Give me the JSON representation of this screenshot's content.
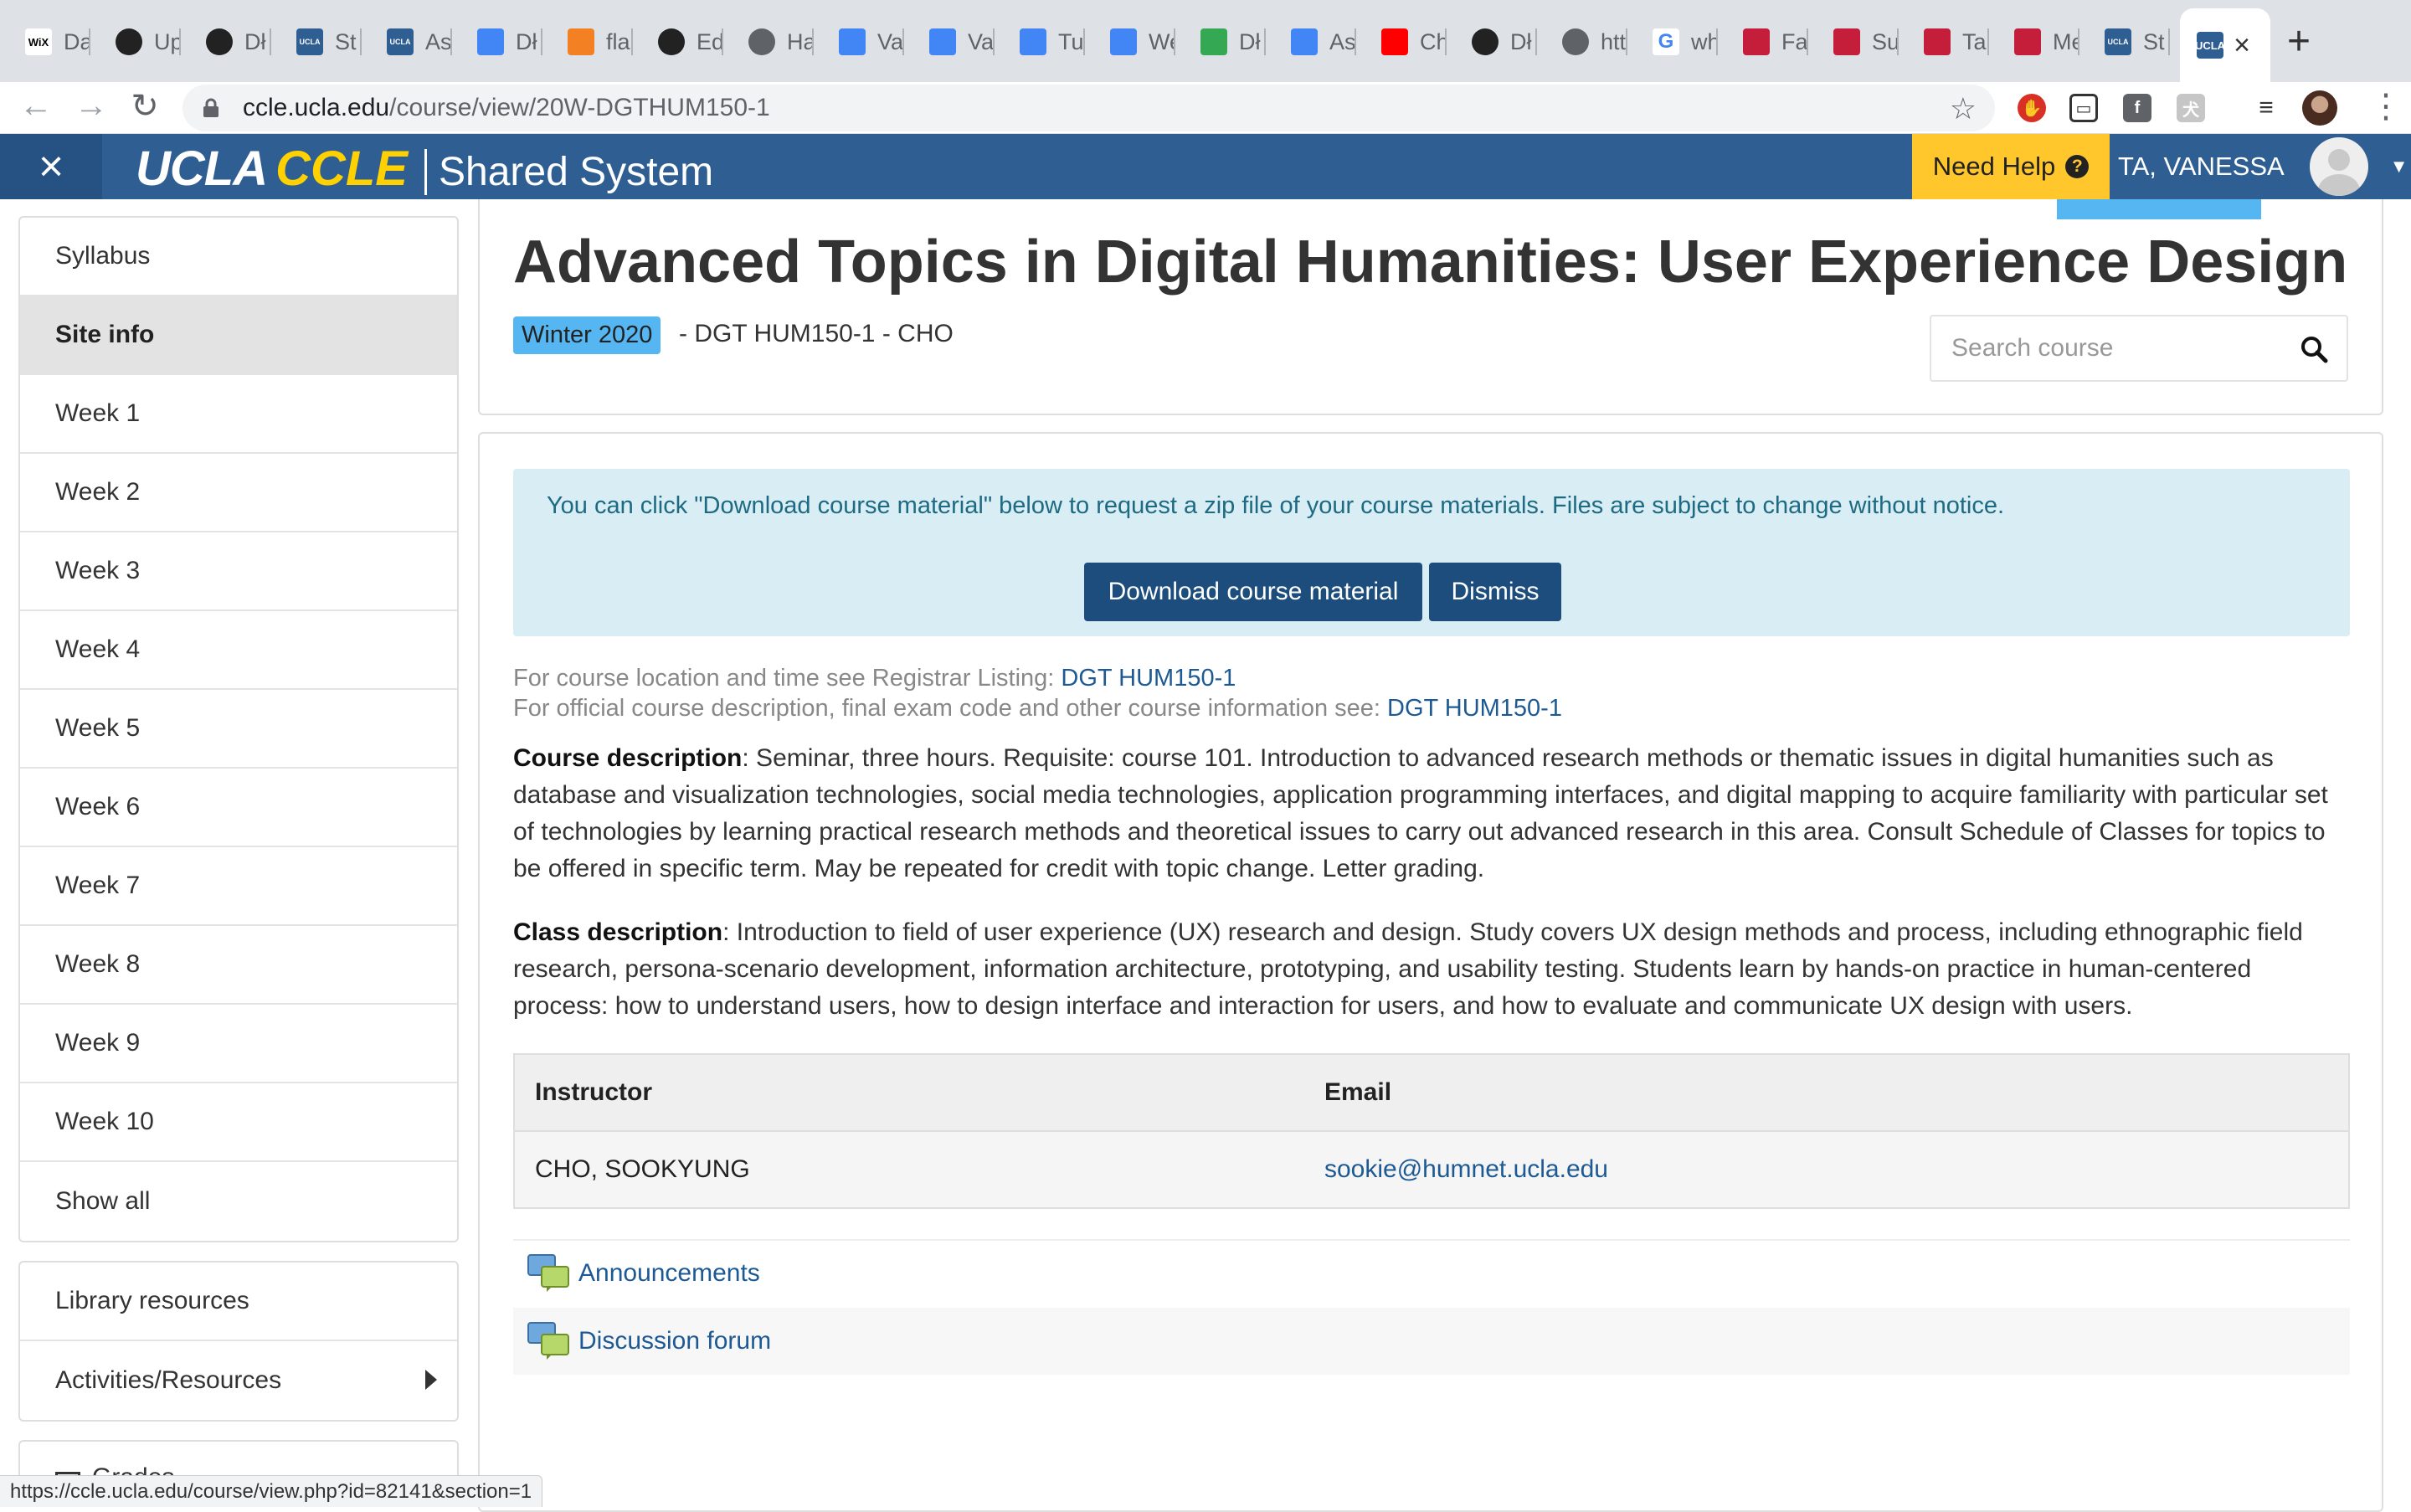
{
  "browser": {
    "tabs": [
      {
        "label": "Da",
        "icon": "wix-icon",
        "color": "#ffffff"
      },
      {
        "label": "Up",
        "icon": "github-icon",
        "color": "#222222"
      },
      {
        "label": "Dł",
        "icon": "github-icon",
        "color": "#222222"
      },
      {
        "label": "St",
        "icon": "ucla-icon",
        "color": "#2f5e93"
      },
      {
        "label": "As",
        "icon": "ucla-icon",
        "color": "#2f5e93"
      },
      {
        "label": "Dł",
        "icon": "docs-icon",
        "color": "#4285f4"
      },
      {
        "label": "fla",
        "icon": "stackoverflow-icon",
        "color": "#f48024"
      },
      {
        "label": "Ed",
        "icon": "github-icon",
        "color": "#222222"
      },
      {
        "label": "Ha",
        "icon": "globe-icon",
        "color": "#5f6368"
      },
      {
        "label": "Va",
        "icon": "docs-icon",
        "color": "#4285f4"
      },
      {
        "label": "Va",
        "icon": "docs-icon",
        "color": "#4285f4"
      },
      {
        "label": "Tu",
        "icon": "docs-icon",
        "color": "#4285f4"
      },
      {
        "label": "We",
        "icon": "docs-icon",
        "color": "#4285f4"
      },
      {
        "label": "Dł",
        "icon": "drive-icon",
        "color": "#34a853"
      },
      {
        "label": "As",
        "icon": "docs-icon",
        "color": "#4285f4"
      },
      {
        "label": "Ch",
        "icon": "youtube-icon",
        "color": "#ff0000"
      },
      {
        "label": "Dł",
        "icon": "github-icon",
        "color": "#222222"
      },
      {
        "label": "htt",
        "icon": "globe-icon",
        "color": "#5f6368"
      },
      {
        "label": "wh",
        "icon": "google-icon",
        "color": "#4285f4"
      },
      {
        "label": "Fa",
        "icon": "hyperlink-icon",
        "color": "#c41e3a"
      },
      {
        "label": "Su",
        "icon": "hyperlink-icon",
        "color": "#c41e3a"
      },
      {
        "label": "Ta",
        "icon": "hyperlink-icon",
        "color": "#c41e3a"
      },
      {
        "label": "Me",
        "icon": "hyperlink-icon",
        "color": "#c41e3a"
      },
      {
        "label": "St",
        "icon": "ucla-icon",
        "color": "#2f5e93"
      }
    ],
    "url_host": "ccle.ucla.edu",
    "url_path": "/course/view/20W-DGTHUM150-1",
    "status_url": "https://ccle.ucla.edu/course/view.php?id=82141&section=1"
  },
  "header": {
    "brand_ucla": "UCLA",
    "brand_ccle": "CCLE",
    "brand_system": "Shared System",
    "need_help": "Need Help",
    "user_name": "TA, VANESSA",
    "colors": {
      "bar": "#2f5e93",
      "help": "#ffc72c",
      "brand_gold": "#ffd100"
    }
  },
  "sidebar": {
    "items": [
      {
        "label": "Syllabus",
        "active": false
      },
      {
        "label": "Site info",
        "active": true
      },
      {
        "label": "Week 1",
        "active": false
      },
      {
        "label": "Week 2",
        "active": false
      },
      {
        "label": "Week 3",
        "active": false
      },
      {
        "label": "Week 4",
        "active": false
      },
      {
        "label": "Week 5",
        "active": false
      },
      {
        "label": "Week 6",
        "active": false
      },
      {
        "label": "Week 7",
        "active": false
      },
      {
        "label": "Week 8",
        "active": false
      },
      {
        "label": "Week 9",
        "active": false
      },
      {
        "label": "Week 10",
        "active": false
      },
      {
        "label": "Show all",
        "active": false
      }
    ],
    "resources": [
      {
        "label": "Library resources"
      },
      {
        "label": "Activities/Resources"
      }
    ],
    "partial_label": "Grades"
  },
  "course": {
    "title": "Advanced Topics in Digital Humanities: User Experience Design",
    "term": "Winter 2020",
    "code": "- DGT HUM150-1 - CHO",
    "search_placeholder": "Search course"
  },
  "notice": {
    "text": "You can click \"Download course material\" below to request a zip file of your course materials. Files are subject to change without notice.",
    "download_label": "Download course material",
    "dismiss_label": "Dismiss"
  },
  "registrar": {
    "location_prefix": "For course location and time see Registrar Listing: ",
    "location_link": "DGT HUM150-1",
    "official_prefix": "For official course description, final exam code and other course information see: ",
    "official_link": "DGT HUM150-1"
  },
  "descriptions": {
    "course_label": "Course description",
    "course_text": ": Seminar, three hours. Requisite: course 101. Introduction to advanced research methods or thematic issues in digital humanities such as database and visualization technologies, social media technologies, application programming interfaces, and digital mapping to acquire familiarity with particular set of technologies by learning practical research methods and theoretical issues to carry out advanced research in this area. Consult Schedule of Classes for topics to be offered in specific term. May be repeated for credit with topic change. Letter grading.",
    "class_label": "Class description",
    "class_text": ": Introduction to field of user experience (UX) research and design. Study covers UX design methods and process, including ethnographic field research, persona-scenario development, information architecture, prototyping, and usability testing. Students learn by hands-on practice in human-centered process: how to understand users, how to design interface and interaction for users, and how to evaluate and communicate UX design with users."
  },
  "instructors": {
    "headers": [
      "Instructor",
      "Email"
    ],
    "rows": [
      [
        "CHO, SOOKYUNG",
        "sookie@humnet.ucla.edu"
      ]
    ]
  },
  "activities": [
    {
      "label": "Announcements",
      "icon": "forum-icon"
    },
    {
      "label": "Discussion forum",
      "icon": "forum-icon"
    }
  ]
}
